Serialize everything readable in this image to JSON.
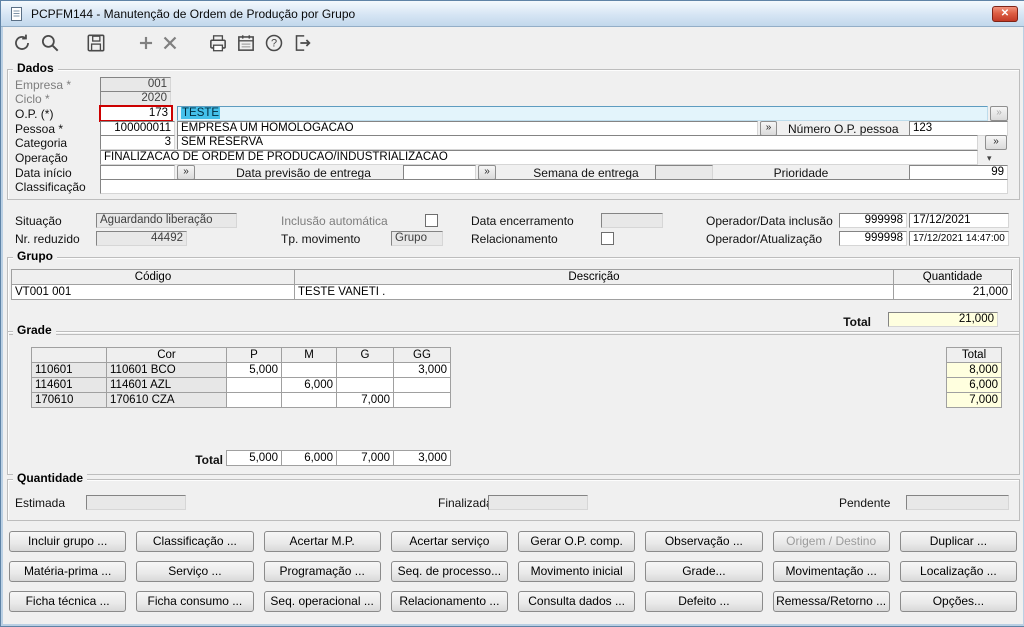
{
  "window": {
    "title": "PCPFM144 - Manutenção de Ordem de Produção por Grupo"
  },
  "glyphs": {
    "more": "»",
    "dropdown": "▾",
    "close": "✕"
  },
  "colors": {
    "title_bar": "#c9dcee",
    "close_button": "#c23a26",
    "selection_highlight": "#45c0ea",
    "total_field": "#ffffdf",
    "required_border": "#cc0000",
    "window_bg": "#f0f0f0"
  },
  "toolbar": {
    "icons": [
      "refresh-icon",
      "search-icon",
      "save-icon",
      "add-icon",
      "delete-icon",
      "print-icon",
      "calendar-icon",
      "help-icon",
      "exit-icon"
    ]
  },
  "dados": {
    "legend": "Dados",
    "empresa_label": "Empresa *",
    "empresa_value": "001",
    "ciclo_label": "Ciclo *",
    "ciclo_value": "2020",
    "op_label": "O.P. (*)",
    "op_value": "173",
    "op_desc": "TESTE",
    "pessoa_label": "Pessoa *",
    "pessoa_code": "100000011",
    "pessoa_name": "EMPRESA UM HOMOLOGACAO",
    "num_op_label": "Número O.P. pessoa",
    "num_op_value": "123",
    "categoria_label": "Categoria",
    "categoria_code": "3",
    "categoria_name": "SEM RESERVA",
    "operacao_label": "Operação",
    "operacao_value": "FINALIZACAO DE ORDEM DE PRODUCAO/INDUSTRIALIZACAO",
    "data_inicio_label": "Data início",
    "data_inicio_value": "",
    "data_previsao_label": "Data previsão de entrega",
    "data_previsao_value": "",
    "semana_label": "Semana de entrega",
    "semana_value": "",
    "prioridade_label": "Prioridade",
    "prioridade_value": "99",
    "classificacao_label": "Classificação",
    "classificacao_value": ""
  },
  "status": {
    "situacao_label": "Situação",
    "situacao_value": "Aguardando liberação",
    "nr_reduzido_label": "Nr. reduzido",
    "nr_reduzido_value": "44492",
    "inclusao_label": "Inclusão automática",
    "tp_movimento_label": "Tp. movimento",
    "tp_movimento_value": "Grupo",
    "encerramento_label": "Data encerramento",
    "encerramento_value": "",
    "relacionamento_label": "Relacionamento",
    "op_inclusao_label": "Operador/Data inclusão",
    "op_inclusao_code": "999998",
    "op_inclusao_date": "17/12/2021",
    "op_atualizacao_label": "Operador/Atualização",
    "op_atualizacao_code": "999998",
    "op_atualizacao_date": "17/12/2021 14:47:00"
  },
  "grupo": {
    "legend": "Grupo",
    "col_codigo": "Código",
    "col_descricao": "Descrição",
    "col_quantidade": "Quantidade",
    "row": {
      "codigo": "VT001 001",
      "descricao": "TESTE VANETI .",
      "quantidade": "21,000"
    },
    "total_label": "Total",
    "total_value": "21,000"
  },
  "grade": {
    "legend": "Grade",
    "col_cor": "Cor",
    "col_p": "P",
    "col_m": "M",
    "col_g": "G",
    "col_gg": "GG",
    "col_total": "Total",
    "rows": [
      {
        "codigo": "110601",
        "cor": "110601 BCO",
        "p": "5,000",
        "m": "",
        "g": "",
        "gg": "3,000",
        "total": "8,000"
      },
      {
        "codigo": "114601",
        "cor": "114601 AZL",
        "p": "",
        "m": "6,000",
        "g": "",
        "gg": "",
        "total": "6,000"
      },
      {
        "codigo": "170610",
        "cor": "170610 CZA",
        "p": "",
        "m": "",
        "g": "7,000",
        "gg": "",
        "total": "7,000"
      }
    ],
    "total_label": "Total",
    "total_p": "5,000",
    "total_m": "6,000",
    "total_g": "7,000",
    "total_gg": "3,000"
  },
  "quantidade": {
    "legend": "Quantidade",
    "estimada_label": "Estimada",
    "estimada_value": "",
    "finalizada_label": "Finalizada",
    "finalizada_value": "",
    "pendente_label": "Pendente",
    "pendente_value": ""
  },
  "buttons": {
    "row1": [
      "Incluir grupo ...",
      "Classificação ...",
      "Acertar M.P.",
      "Acertar serviço",
      "Gerar O.P. comp.",
      "Observação ...",
      "Origem / Destino",
      "Duplicar ..."
    ],
    "row2": [
      "Matéria-prima ...",
      "Serviço ...",
      "Programação ...",
      "Seq. de processo...",
      "Movimento inicial",
      "Grade...",
      "Movimentação ...",
      "Localização ..."
    ],
    "row3": [
      "Ficha técnica ...",
      "Ficha consumo ...",
      "Seq. operacional ...",
      "Relacionamento ...",
      "Consulta dados ...",
      "Defeito ...",
      "Remessa/Retorno ...",
      "Opções..."
    ]
  }
}
